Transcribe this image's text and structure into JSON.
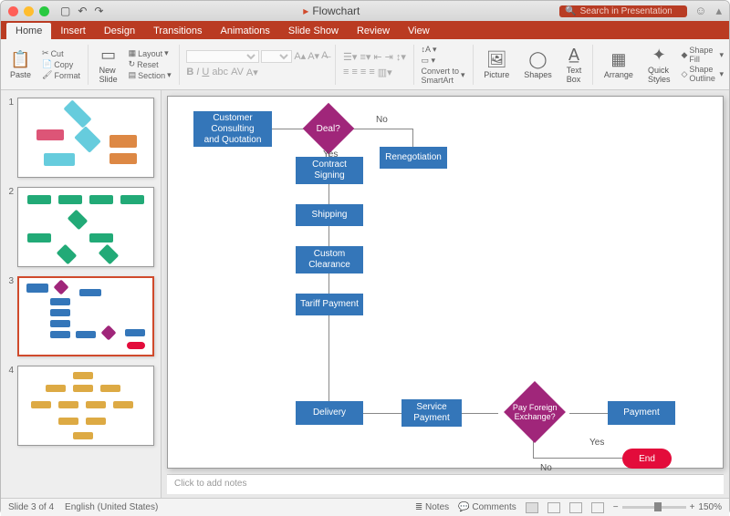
{
  "title": "Flowchart",
  "search_placeholder": "Search in Presentation",
  "tabs": [
    "Home",
    "Insert",
    "Design",
    "Transitions",
    "Animations",
    "Slide Show",
    "Review",
    "View"
  ],
  "ribbon": {
    "paste": "Paste",
    "cut": "Cut",
    "copy": "Copy",
    "format": "Format",
    "newslide": "New\nSlide",
    "layout": "Layout",
    "reset": "Reset",
    "section": "Section",
    "convert": "Convert to\nSmartArt",
    "picture": "Picture",
    "shapes": "Shapes",
    "textbox": "Text\nBox",
    "arrange": "Arrange",
    "quick": "Quick\nStyles",
    "sfill": "Shape Fill",
    "soutline": "Shape Outline"
  },
  "thumbs": [
    "1",
    "2",
    "3",
    "4"
  ],
  "notes_placeholder": "Click to add notes",
  "status": {
    "slide": "Slide 3 of 4",
    "lang": "English (United States)",
    "notes": "Notes",
    "comments": "Comments",
    "zoom": "150%"
  },
  "flow": {
    "customer": "Customer\nConsulting\nand Quotation",
    "deal": "Deal?",
    "no": "No",
    "yes": "Yes",
    "reneg": "Renegotiation",
    "contract": "Contract\nSigning",
    "shipping": "Shipping",
    "custom": "Custom\nClearance",
    "tariff": "Tariff Payment",
    "delivery": "Delivery",
    "service": "Service\nPayment",
    "payfx": "Pay Foreign\nExchange?",
    "payment": "Payment",
    "end": "End"
  },
  "chart_data": {
    "type": "flowchart",
    "nodes": [
      {
        "id": "customer",
        "type": "process",
        "label": "Customer Consulting and Quotation"
      },
      {
        "id": "deal",
        "type": "decision",
        "label": "Deal?"
      },
      {
        "id": "reneg",
        "type": "process",
        "label": "Renegotiation"
      },
      {
        "id": "contract",
        "type": "process",
        "label": "Contract Signing"
      },
      {
        "id": "shipping",
        "type": "process",
        "label": "Shipping"
      },
      {
        "id": "custom",
        "type": "process",
        "label": "Custom Clearance"
      },
      {
        "id": "tariff",
        "type": "process",
        "label": "Tariff Payment"
      },
      {
        "id": "delivery",
        "type": "process",
        "label": "Delivery"
      },
      {
        "id": "service",
        "type": "process",
        "label": "Service Payment"
      },
      {
        "id": "payfx",
        "type": "decision",
        "label": "Pay Foreign Exchange?"
      },
      {
        "id": "payment",
        "type": "process",
        "label": "Payment"
      },
      {
        "id": "end",
        "type": "terminator",
        "label": "End"
      }
    ],
    "edges": [
      {
        "from": "customer",
        "to": "deal"
      },
      {
        "from": "deal",
        "to": "reneg",
        "label": "No"
      },
      {
        "from": "deal",
        "to": "contract",
        "label": "Yes"
      },
      {
        "from": "contract",
        "to": "shipping"
      },
      {
        "from": "shipping",
        "to": "custom"
      },
      {
        "from": "custom",
        "to": "tariff"
      },
      {
        "from": "tariff",
        "to": "delivery"
      },
      {
        "from": "delivery",
        "to": "service"
      },
      {
        "from": "service",
        "to": "payfx"
      },
      {
        "from": "payfx",
        "to": "payment"
      },
      {
        "from": "payfx",
        "to": "end",
        "label": "Yes"
      },
      {
        "from": "payfx",
        "label": "No"
      }
    ]
  }
}
